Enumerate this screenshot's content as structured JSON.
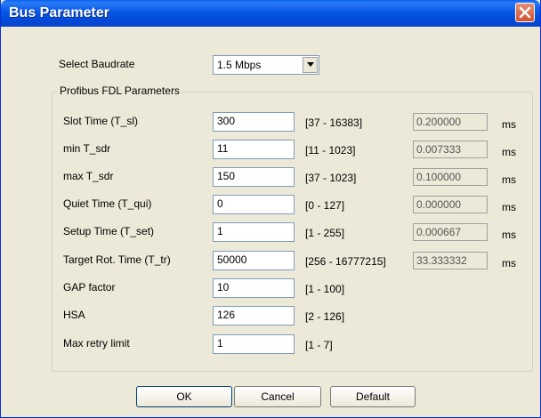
{
  "window": {
    "title": "Bus Parameter"
  },
  "baudrate": {
    "label": "Select Baudrate",
    "value": "1.5 Mbps"
  },
  "group": {
    "title": "Profibus FDL Parameters"
  },
  "params": [
    {
      "label": "Slot Time (T_sl)",
      "value": "300",
      "range": "[37 - 16383]",
      "time": "0.200000",
      "unit": "ms"
    },
    {
      "label": "min T_sdr",
      "value": "11",
      "range": "[11 - 1023]",
      "time": "0.007333",
      "unit": "ms"
    },
    {
      "label": "max T_sdr",
      "value": "150",
      "range": "[37 - 1023]",
      "time": "0.100000",
      "unit": "ms"
    },
    {
      "label": "Quiet Time (T_qui)",
      "value": "0",
      "range": "[0 - 127]",
      "time": "0.000000",
      "unit": "ms"
    },
    {
      "label": "Setup Time (T_set)",
      "value": "1",
      "range": "[1 - 255]",
      "time": "0.000667",
      "unit": "ms"
    },
    {
      "label": "Target Rot. Time (T_tr)",
      "value": "50000",
      "range": "[256 - 16777215]",
      "time": "33.333332",
      "unit": "ms"
    },
    {
      "label": "GAP factor",
      "value": "10",
      "range": "[1 - 100]"
    },
    {
      "label": "HSA",
      "value": "126",
      "range": "[2 - 126]"
    },
    {
      "label": "Max retry limit",
      "value": "1",
      "range": "[1 - 7]"
    }
  ],
  "buttons": {
    "ok": "OK",
    "cancel": "Cancel",
    "default": "Default"
  }
}
